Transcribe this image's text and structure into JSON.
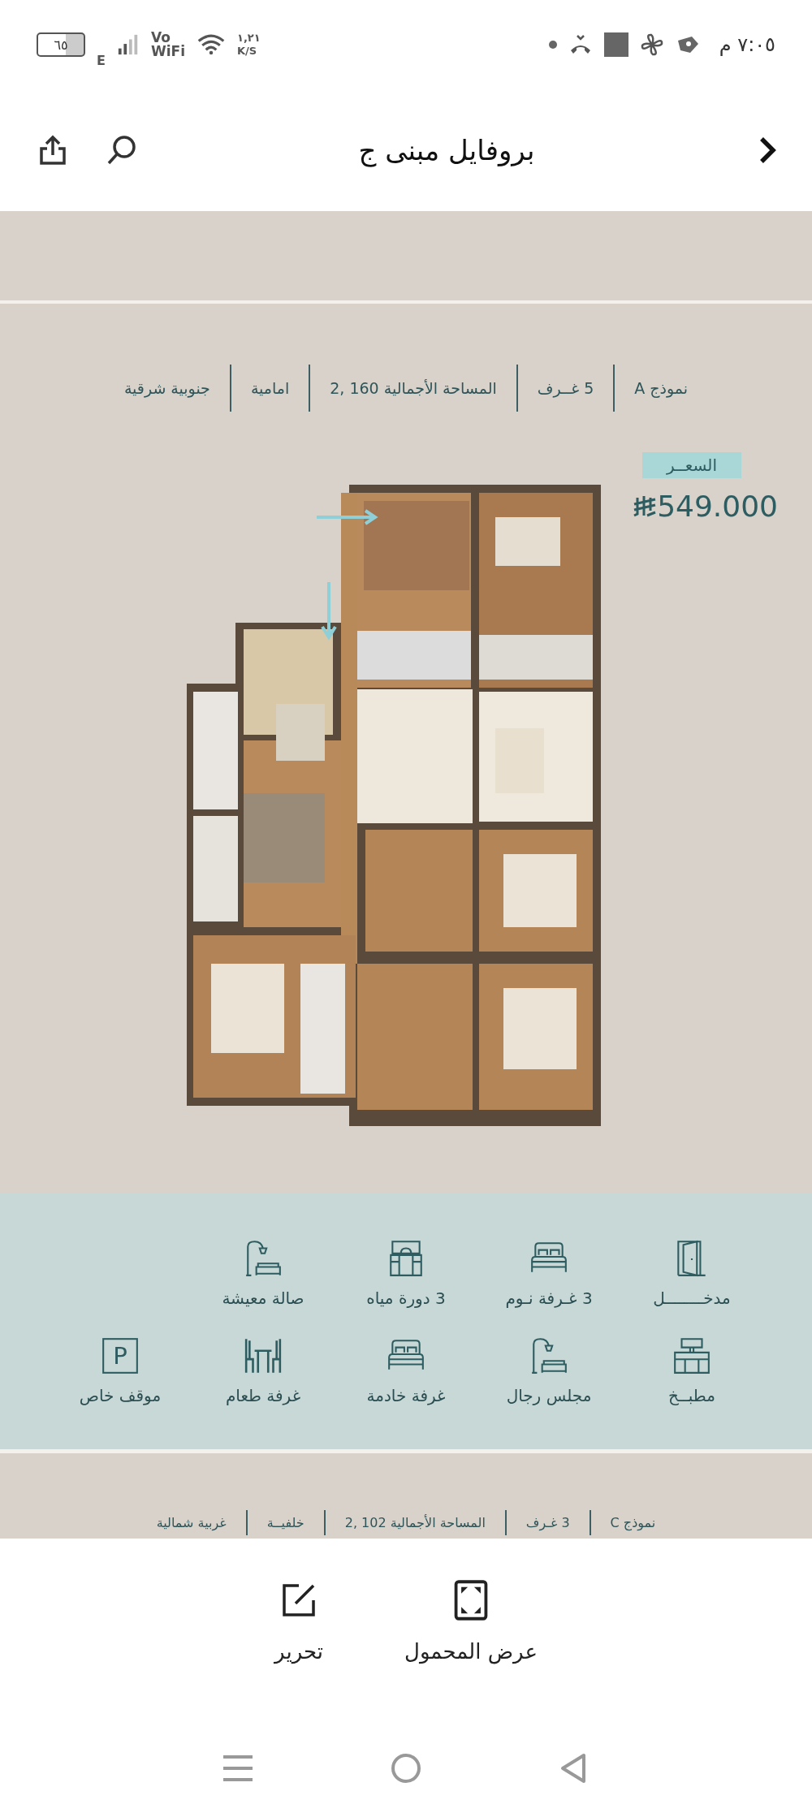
{
  "status_bar": {
    "time": "٧:٠٥ م",
    "battery": "٦٥",
    "network": "E",
    "vowifi": [
      "Vo",
      "WiFi"
    ],
    "speed": [
      "١,٢١",
      "K/S"
    ]
  },
  "header": {
    "title": "بروفايل مبنى ج"
  },
  "document": {
    "specs": [
      "نموذج A",
      "5 غــرف",
      "المساحة الأجمالية 160 ,2",
      "امامية",
      "جنوبية شرقية"
    ],
    "price_label": "السعــر",
    "price": "549.000",
    "amenities": [
      {
        "label": "مدخــــــــل",
        "kind": "door"
      },
      {
        "label": "3 غـرفة نـوم",
        "kind": "bed"
      },
      {
        "label": "3 دورة مياه",
        "kind": "sink"
      },
      {
        "label": "صالة معيشة",
        "kind": "lounge"
      },
      {
        "label": "مطبــخ",
        "kind": "kitchen"
      },
      {
        "label": "مجلس رجال",
        "kind": "lounge"
      },
      {
        "label": "غرفة خادمة",
        "kind": "bed"
      },
      {
        "label": "غرفة طعام",
        "kind": "dining"
      },
      {
        "label": "موقف خاص",
        "kind": "parking",
        "glyph": "P"
      }
    ],
    "next_specs": [
      "نموذج C",
      "3 غـرف",
      "المساحة الأجمالية 102 ,2",
      "خلفيــة",
      "غربية شمالية"
    ]
  },
  "actions": [
    {
      "label": "عرض المحمول",
      "kind": "fullscreen"
    },
    {
      "label": "تحرير",
      "kind": "edit"
    }
  ]
}
